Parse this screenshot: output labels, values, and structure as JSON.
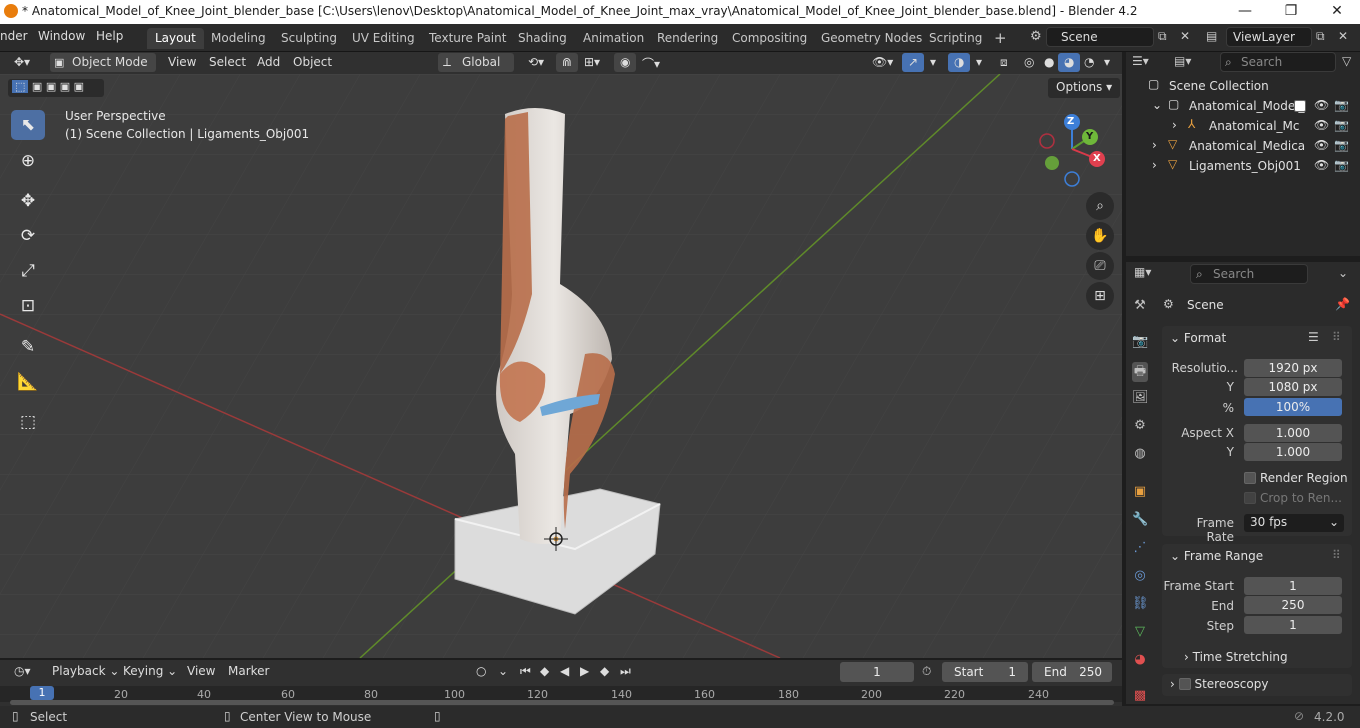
{
  "titlebar": {
    "title": "* Anatomical_Model_of_Knee_Joint_blender_base [C:\\Users\\lenov\\Desktop\\Anatomical_Model_of_Knee_Joint_max_vray\\Anatomical_Model_of_Knee_Joint_blender_base.blend] - Blender 4.2",
    "minimize": "—",
    "maximize": "❐",
    "close": "✕"
  },
  "menus": [
    "nder",
    "Window",
    "Help"
  ],
  "workspaces": [
    "Layout",
    "Modeling",
    "Sculpting",
    "UV Editing",
    "Texture Paint",
    "Shading",
    "Animation",
    "Rendering",
    "Compositing",
    "Geometry Nodes",
    "Scripting"
  ],
  "add_workspace": "+",
  "scene_field": "Scene",
  "viewlayer_field": "ViewLayer",
  "vp_header": {
    "mode": "Object Mode",
    "view": "View",
    "select": "Select",
    "add": "Add",
    "object": "Object",
    "orientation": "Global"
  },
  "options_label": "Options",
  "overlay": {
    "perspective": "User Perspective",
    "collection": "(1) Scene Collection | Ligaments_Obj001"
  },
  "gizmo": {
    "z": "Z",
    "y": "Y",
    "x": "X"
  },
  "outliner": {
    "search_placeholder": "Search",
    "rows": [
      {
        "label": "Scene Collection"
      },
      {
        "label": "Anatomical_Model_"
      },
      {
        "label": "Anatomical_Mc"
      },
      {
        "label": "Anatomical_Medica"
      },
      {
        "label": "Ligaments_Obj001"
      }
    ]
  },
  "props": {
    "search_placeholder": "Search",
    "context": "Scene",
    "format_title": "Format",
    "resolution_label": "Resolutio...",
    "res_x": "1920 px",
    "y_label": "Y",
    "res_y": "1080 px",
    "pct_label": "%",
    "pct": "100%",
    "aspect_label": "Aspect X",
    "aspect_x": "1.000",
    "aspect_y_label": "Y",
    "aspect_y": "1.000",
    "render_region": "Render Region",
    "crop": "Crop to Ren...",
    "frame_rate_label": "Frame Rate",
    "frame_rate": "30 fps",
    "frame_range_title": "Frame Range",
    "frame_start_label": "Frame Start",
    "frame_start": "1",
    "end_label": "End",
    "end": "250",
    "step_label": "Step",
    "step": "1",
    "time_stretching": "Time Stretching",
    "stereoscopy": "Stereoscopy"
  },
  "timeline": {
    "playback": "Playback",
    "keying": "Keying",
    "view": "View",
    "marker": "Marker",
    "current": "1",
    "start_label": "Start",
    "start": "1",
    "end_label": "End",
    "end": "250",
    "ticks": [
      "1",
      "20",
      "40",
      "60",
      "80",
      "100",
      "120",
      "140",
      "160",
      "180",
      "200",
      "220",
      "240"
    ]
  },
  "status": {
    "select": "Select",
    "center": "Center View to Mouse",
    "version": "4.2.0"
  }
}
